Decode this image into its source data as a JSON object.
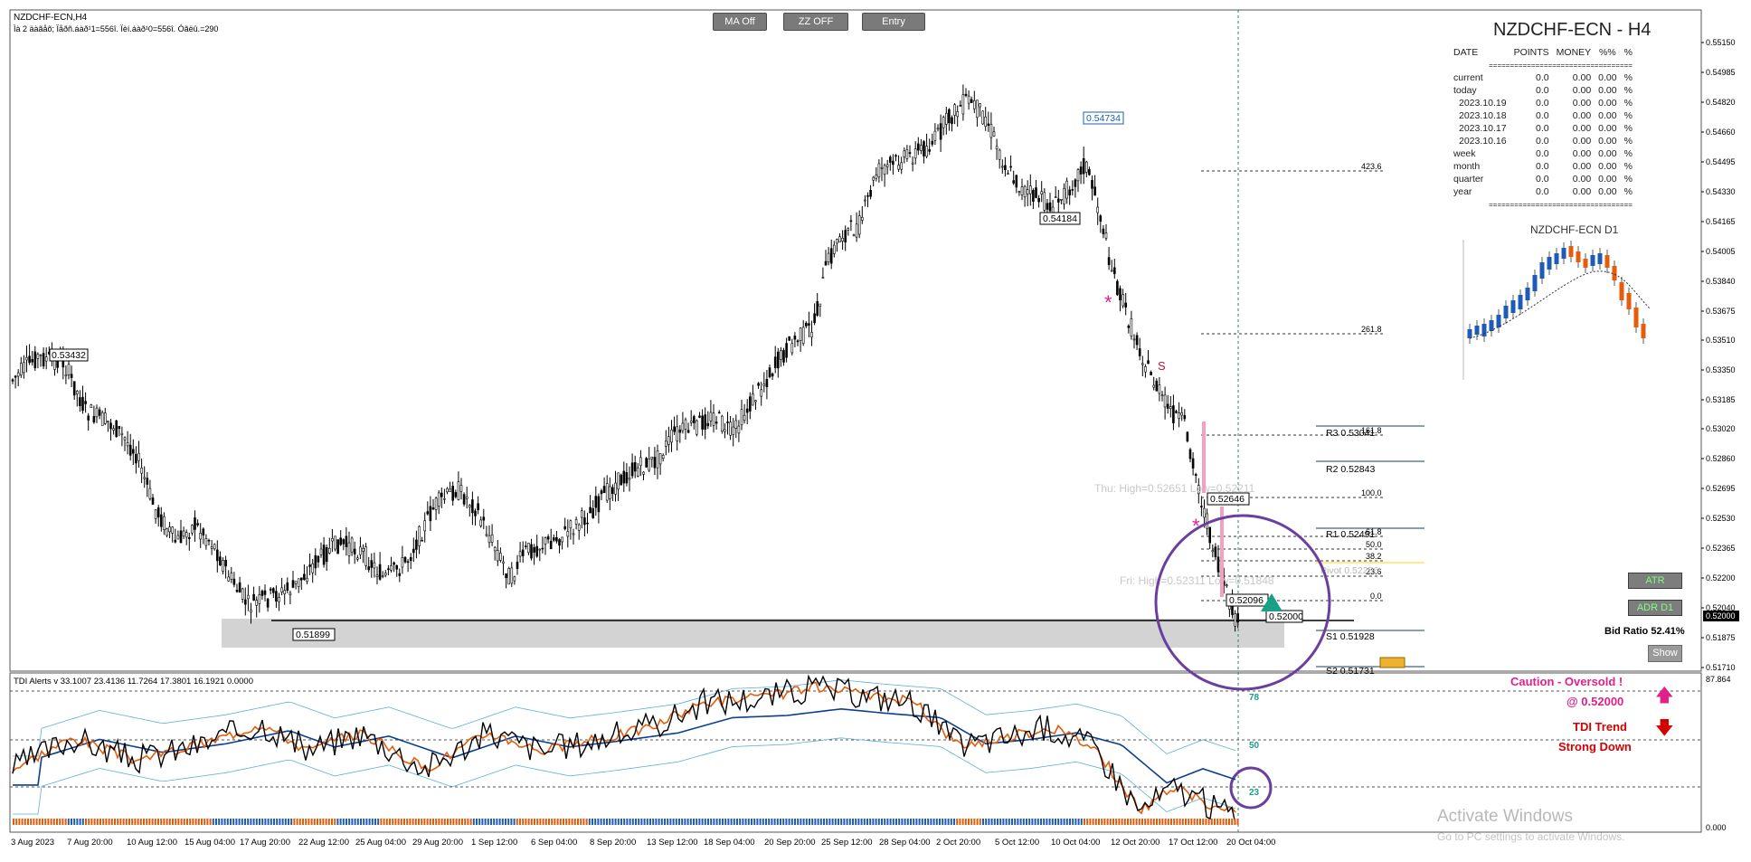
{
  "window": {
    "symbol_label": "NZDCHF-ECN,H4",
    "subtitle": "Ìà 2 äàãåõ; Ïåðñ.áàð¹1=556î. Ïèí.áàð¹0=556î. Óãëû.=290"
  },
  "toolbar": {
    "ma_label": "MA Off",
    "zz_label": "ZZ OFF",
    "entry_label": "Entry"
  },
  "colors": {
    "grid": "#7a7a7a",
    "candle": "#000000",
    "zone": "#d3d3d3",
    "circle": "#6b3fa0",
    "pink": "#e0218a",
    "teal": "#1aa085",
    "red": "#d50000",
    "tdi_orange": "#e35d0a",
    "tdi_blue": "#0d3f8f",
    "tdi_band": "#5aaee0",
    "bear": "#e35d0a",
    "bull": "#1f5bb3"
  },
  "price_axis": {
    "ticks": [
      "0.55150",
      "0.54985",
      "0.54820",
      "0.54660",
      "0.54495",
      "0.54330",
      "0.54165",
      "0.54005",
      "0.53840",
      "0.53675",
      "0.53510",
      "0.53350",
      "0.53185",
      "0.53020",
      "0.52860",
      "0.52695",
      "0.52530",
      "0.52365",
      "0.52200",
      "0.52040",
      "0.52000",
      "0.51875",
      "0.51710"
    ],
    "current": "0.52000"
  },
  "time_axis": {
    "labels": [
      "3 Aug 2023",
      "7 Aug 20:00",
      "10 Aug 12:00",
      "15 Aug 04:00",
      "17 Aug 20:00",
      "22 Aug 12:00",
      "25 Aug 04:00",
      "29 Aug 20:00",
      "1 Sep 12:00",
      "6 Sep 04:00",
      "8 Sep 20:00",
      "13 Sep 12:00",
      "18 Sep 04:00",
      "20 Sep 20:00",
      "25 Sep 12:00",
      "28 Sep 04:00",
      "2 Oct 20:00",
      "5 Oct 12:00",
      "10 Oct 04:00",
      "12 Oct 20:00",
      "17 Oct 12:00",
      "20 Oct 04:00"
    ]
  },
  "chart_labels": {
    "high_box": "0.54734",
    "mid_box": "0.54184",
    "left_box": "0.53432",
    "low_box": "0.51899",
    "box_52646": "0.52646",
    "box_52096": "0.52096",
    "box_52000": "0.52000",
    "s_marker": "S",
    "star": "*",
    "thu_text": "Thu:  High=0.52651  Low=0.52211",
    "fri_text": "Fri:  High=0.52311  Low=0.51848",
    "fib": [
      "423.6",
      "261.8",
      "161.8",
      "100.0",
      "61.8",
      "50.0",
      "38.2",
      "23.6",
      "0.0"
    ],
    "pivots": [
      "R3 0.53041",
      "R2 0.52843",
      "R1 0.52491",
      "Pivot 0.52256",
      "S1 0.51928",
      "S2 0.51731"
    ]
  },
  "panel": {
    "title": "NZDCHF-ECN - H4",
    "headers": [
      "DATE",
      "POINTS",
      "MONEY",
      "%%",
      "%"
    ],
    "separator": "==================================",
    "rows": [
      {
        "date": "current",
        "points": "0.0",
        "money": "0.00",
        "pct": "0.00",
        "sym": "%"
      },
      {
        "date": "today",
        "points": "0.0",
        "money": "0.00",
        "pct": "0.00",
        "sym": "%"
      },
      {
        "date": "2023.10.19",
        "points": "0.0",
        "money": "0.00",
        "pct": "0.00",
        "sym": "%"
      },
      {
        "date": "2023.10.18",
        "points": "0.0",
        "money": "0.00",
        "pct": "0.00",
        "sym": "%"
      },
      {
        "date": "2023.10.17",
        "points": "0.0",
        "money": "0.00",
        "pct": "0.00",
        "sym": "%"
      },
      {
        "date": "2023.10.16",
        "points": "0.0",
        "money": "0.00",
        "pct": "0.00",
        "sym": "%"
      },
      {
        "date": "week",
        "points": "0.0",
        "money": "0.00",
        "pct": "0.00",
        "sym": "%"
      },
      {
        "date": "month",
        "points": "0.0",
        "money": "0.00",
        "pct": "0.00",
        "sym": "%"
      },
      {
        "date": "quarter",
        "points": "0.0",
        "money": "0.00",
        "pct": "0.00",
        "sym": "%"
      },
      {
        "date": "year",
        "points": "0.0",
        "money": "0.00",
        "pct": "0.00",
        "sym": "%"
      }
    ],
    "mini_title": "NZDCHF-ECN D1",
    "atr_label": "ATR",
    "adr_label": "ADR D1",
    "bid_ratio": "Bid Ratio 52.41%",
    "show_label": "Show"
  },
  "tdi": {
    "header": "TDI Alerts v 33.1007 23.4136 11.7264 17.3801 16.1921 0.0000",
    "levels": [
      "78",
      "50",
      "23"
    ],
    "axis_top": "87.864",
    "axis_bottom": "0.000",
    "caution": "Caution - Oversold !",
    "price": "@ 0.52000",
    "trend1": "TDI Trend",
    "trend2": "Strong Down",
    "up_arrow": "🡅",
    "down_arrow": "🡇"
  },
  "watermark": {
    "line1": "Activate Windows",
    "line2": "Go to PC settings to activate Windows."
  }
}
